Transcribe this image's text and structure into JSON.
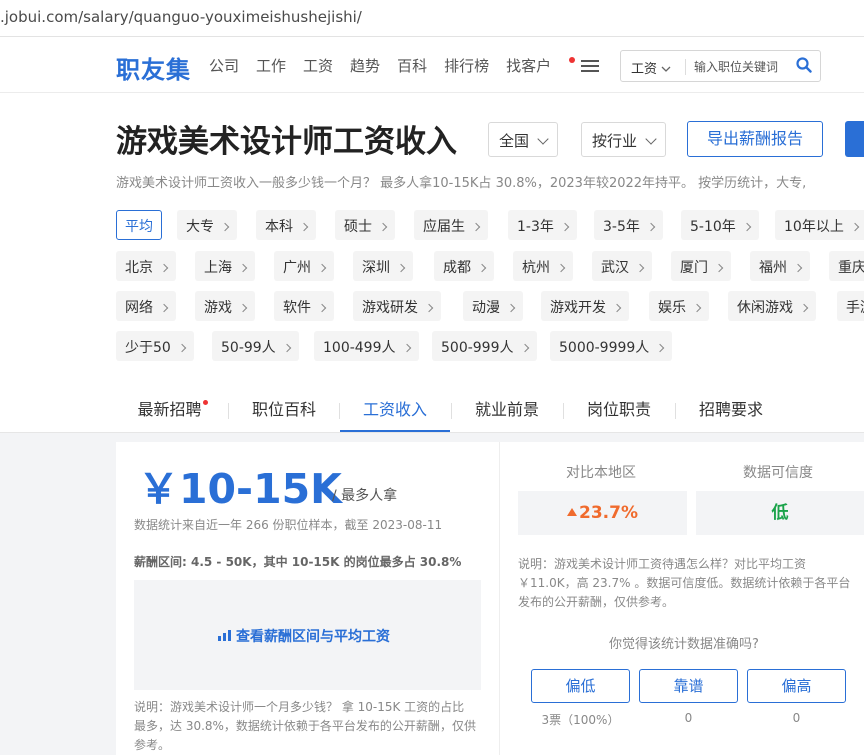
{
  "url": ".jobui.com/salary/quanguo-youximeishushejishi/",
  "header": {
    "logo": "职友集",
    "nav": [
      "公司",
      "工作",
      "工资",
      "趋势",
      "百科",
      "排行榜",
      "找客户"
    ],
    "search": {
      "select": "工资",
      "placeholder": "输入职位关键词"
    }
  },
  "page": {
    "title": "游戏美术设计师工资收入",
    "region_dropdown": "全国",
    "industry_dropdown": "按行业",
    "export_button": "导出薪酬报告",
    "description": "游戏美术设计师工资收入一般多少钱一个月？ 最多人拿10-15K占 30.8%，2023年较2022年持平。 按学历统计，大专,"
  },
  "filters": {
    "row1": [
      "平均",
      "大专",
      "本科",
      "硕士",
      "应届生",
      "1-3年",
      "3-5年",
      "5-10年",
      "10年以上"
    ],
    "row2": [
      "北京",
      "上海",
      "广州",
      "深圳",
      "成都",
      "杭州",
      "武汉",
      "厦门",
      "福州",
      "重庆"
    ],
    "row3": [
      "网络",
      "游戏",
      "软件",
      "游戏研发",
      "动漫",
      "游戏开发",
      "娱乐",
      "休闲游戏",
      "手游"
    ],
    "row4": [
      "少于50",
      "50-99人",
      "100-499人",
      "500-999人",
      "5000-9999人"
    ]
  },
  "tabs": [
    "最新招聘",
    "职位百科",
    "工资收入",
    "就业前景",
    "岗位职责",
    "招聘要求"
  ],
  "salary": {
    "value": "￥10-15K",
    "suffix": "/ 最多人拿",
    "stat_note": "数据统计来自近一年 266 份职位样本，截至 2023-08-11",
    "range_note": "薪酬区间: 4.5 - 50K，其中 10-15K 的岗位最多占 30.8%",
    "chart_link": "查看薪酬区间与平均工资",
    "explain": "说明：游戏美术设计师一个月多少钱？ 拿 10-15K 工资的占比最多，达 30.8%，数据统计依赖于各平台发布的公开薪酬，仅供参考。"
  },
  "compare": {
    "local_label": "对比本地区",
    "local_value": "23.7%",
    "trust_label": "数据可信度",
    "trust_value": "低",
    "explain": "说明：游戏美术设计师工资待遇怎么样？对比平均工资￥11.0K，高 23.7% 。数据可信度低。数据统计依赖于各平台发布的公开薪酬，仅供参考。",
    "question": "你觉得该统计数据准确吗?",
    "votes": [
      {
        "label": "偏低",
        "count": "3票（100%）"
      },
      {
        "label": "靠谱",
        "count": "0"
      },
      {
        "label": "偏高",
        "count": "0"
      }
    ]
  },
  "colors": {
    "accent": "#2a6fd6",
    "up": "#f06b2d",
    "trust_low": "#1aa34a"
  }
}
